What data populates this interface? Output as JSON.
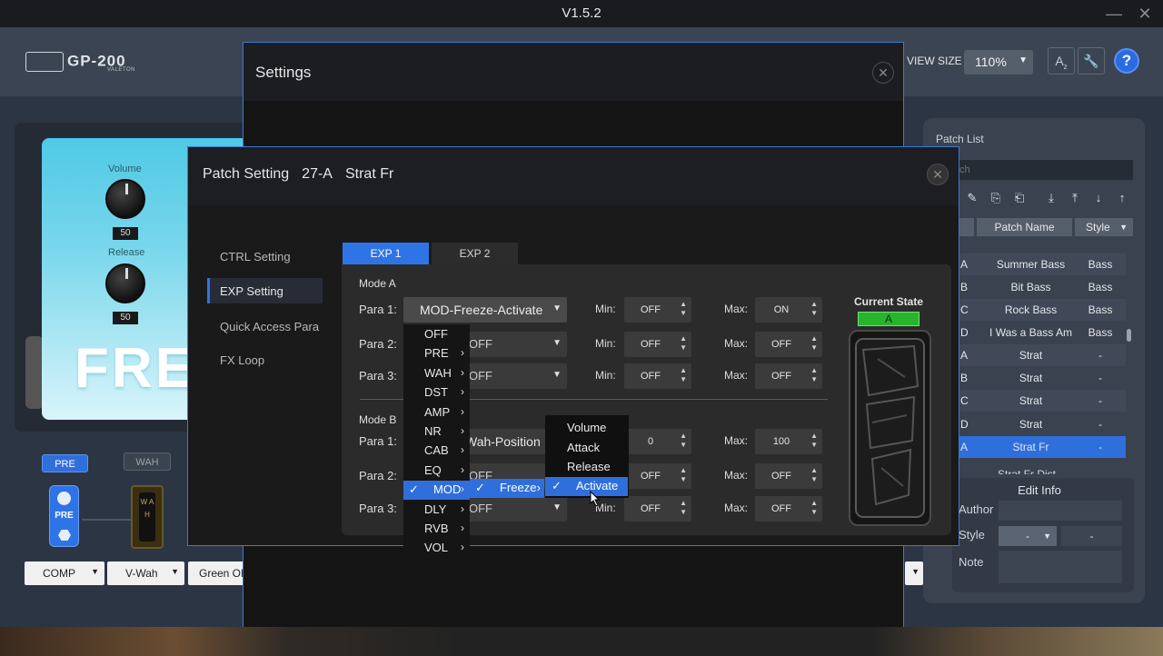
{
  "window": {
    "title": "V1.5.2",
    "minimize_icon": "minimize-icon",
    "close_icon": "close-icon"
  },
  "header": {
    "logo_text": "GP-200",
    "logo_sub": "VALETON",
    "view_size_label": "VIEW SIZE",
    "zoom_value": "110%",
    "buttons": [
      "text-size-icon",
      "wrench-icon"
    ],
    "help_label": "?"
  },
  "pedal": {
    "name_text": "FREE",
    "knobs": [
      {
        "label": "Volume",
        "value": "50"
      },
      {
        "label": "Release",
        "value": "50"
      }
    ]
  },
  "chain": {
    "pre_label": "PRE",
    "wah_label": "WAH",
    "pre_icon_label": "PRE",
    "wah_pedal_letters": "W A H",
    "selects": [
      "COMP",
      "V-Wah",
      "Green OD"
    ]
  },
  "patch_list": {
    "title": "Patch List",
    "search_placeholder": "ch",
    "col_headers": [
      "Patch Name",
      "Style"
    ],
    "rows": [
      {
        "id": "A",
        "name": "Summer Bass",
        "style": "Bass"
      },
      {
        "id": "B",
        "name": "Bit Bass",
        "style": "Bass"
      },
      {
        "id": "C",
        "name": "Rock Bass",
        "style": "Bass"
      },
      {
        "id": "D",
        "name": "I Was a Bass Am",
        "style": "Bass"
      },
      {
        "id": "A",
        "name": "Strat",
        "style": "-"
      },
      {
        "id": "B",
        "name": "Strat",
        "style": "-"
      },
      {
        "id": "C",
        "name": "Strat",
        "style": "-"
      },
      {
        "id": "D",
        "name": "Strat",
        "style": "-"
      },
      {
        "id": "A",
        "name": "Strat Fr",
        "style": "-"
      }
    ],
    "partial_row": "Strat Fr Dist",
    "edit_info": {
      "title": "Edit Info",
      "author_label": "Author",
      "style_label": "Style",
      "note_label": "Note",
      "style_value_1": "-",
      "style_value_2": "-"
    }
  },
  "settings": {
    "title": "Settings"
  },
  "patch_setting": {
    "title": "Patch Setting",
    "patch_id": "27-A",
    "patch_name": "Strat Fr",
    "nav": [
      "CTRL Setting",
      "EXP Setting",
      "Quick Access Para",
      "FX Loop"
    ],
    "tabs": [
      "EXP 1",
      "EXP 2"
    ],
    "mode_a": {
      "label": "Mode A",
      "rows": [
        {
          "label": "Para 1:",
          "value": "MOD-Freeze-Activate",
          "min": "OFF",
          "max": "ON"
        },
        {
          "label": "Para 2:",
          "value": "OFF",
          "min": "OFF",
          "max": "OFF"
        },
        {
          "label": "Para 3:",
          "value": "OFF",
          "min": "OFF",
          "max": "OFF"
        }
      ]
    },
    "mode_b": {
      "label": "Mode B",
      "rows": [
        {
          "label": "Para 1:",
          "value": "Wah-Position",
          "min": "0",
          "max": "100"
        },
        {
          "label": "Para 2:",
          "value": "OFF",
          "min": "OFF",
          "max": "OFF"
        },
        {
          "label": "Para 3:",
          "value": "OFF",
          "min": "OFF",
          "max": "OFF"
        }
      ]
    },
    "min_label": "Min:",
    "max_label": "Max:",
    "current_state_label": "Current State",
    "current_state_value": "A"
  },
  "module_menu": {
    "items": [
      "OFF",
      "PRE",
      "WAH",
      "DST",
      "AMP",
      "NR",
      "CAB",
      "EQ",
      "MOD",
      "DLY",
      "RVB",
      "VOL"
    ],
    "selected": "MOD",
    "effect_item": "Freeze",
    "params": [
      "Volume",
      "Attack",
      "Release",
      "Activate"
    ],
    "selected_param": "Activate"
  }
}
